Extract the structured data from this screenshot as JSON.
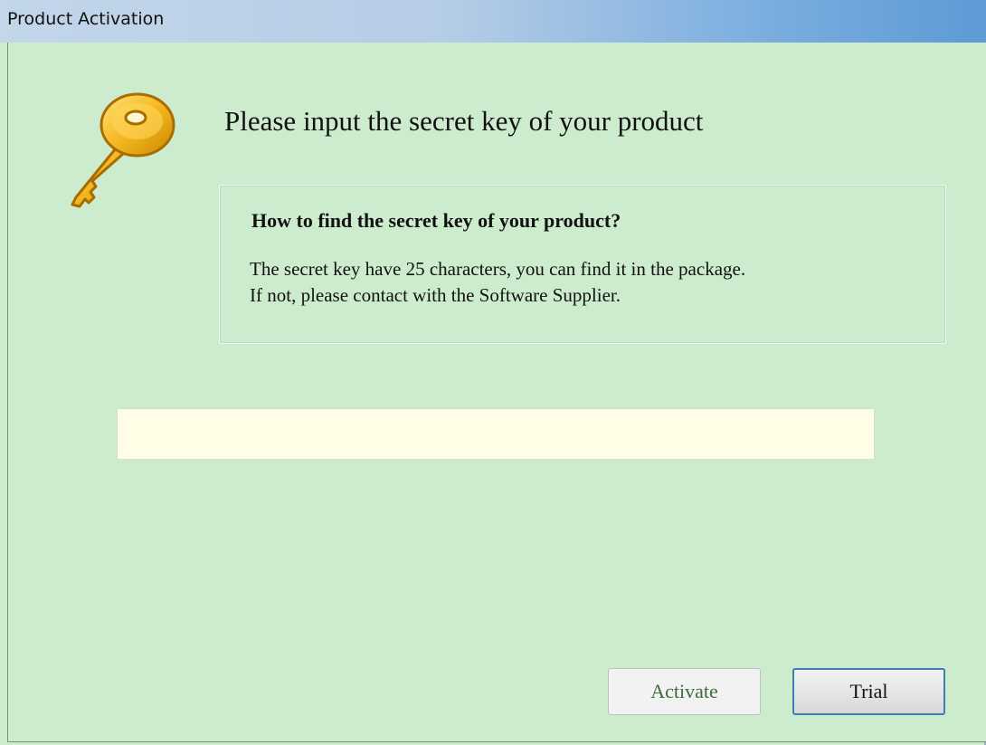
{
  "window": {
    "title": "Product Activation"
  },
  "main": {
    "heading": "Please input the secret key of your product",
    "key_icon": "key-icon"
  },
  "info": {
    "title": "How to find the secret key of your product?",
    "line1": "The secret key have 25 characters, you can find it in the package.",
    "line2": "If not, please contact with the Software Supplier."
  },
  "input": {
    "value": "",
    "placeholder": ""
  },
  "buttons": {
    "activate_label": "Activate",
    "trial_label": "Trial"
  },
  "colors": {
    "background": "#cdebcd",
    "input_background": "#fffde6",
    "key_gold": "#f2b21a",
    "trial_border": "#3c7fb1"
  }
}
